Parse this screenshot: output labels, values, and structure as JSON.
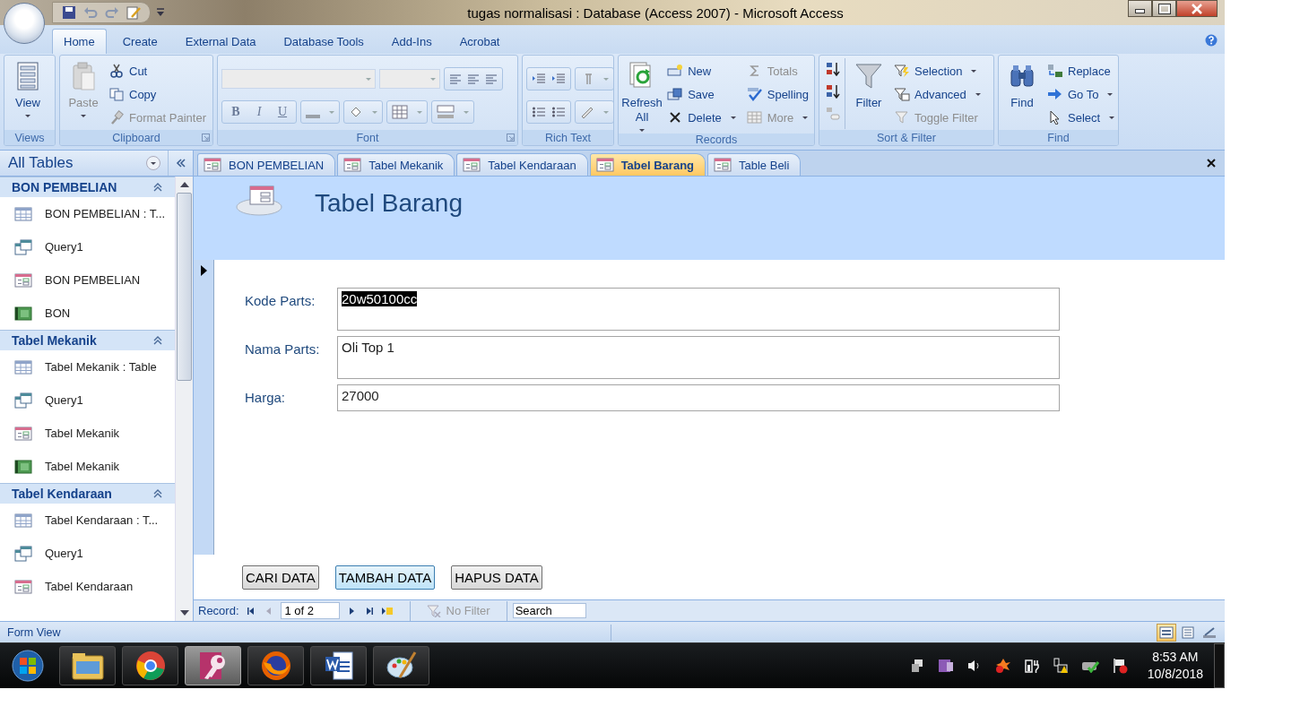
{
  "window": {
    "title": "tugas normalisasi : Database (Access 2007) - Microsoft Access"
  },
  "ribbon_tabs": [
    {
      "label": "Home",
      "selected": true
    },
    {
      "label": "Create",
      "selected": false
    },
    {
      "label": "External Data",
      "selected": false
    },
    {
      "label": "Database Tools",
      "selected": false
    },
    {
      "label": "Add-Ins",
      "selected": false
    },
    {
      "label": "Acrobat",
      "selected": false
    }
  ],
  "ribbon_groups": [
    {
      "label": "Views",
      "kind": "views",
      "commands": [
        {
          "label": "View",
          "kind": "large",
          "disabled": false,
          "menu": true
        }
      ]
    },
    {
      "label": "Clipboard",
      "kind": "clipboard",
      "commands": [
        {
          "label": "Paste",
          "kind": "large",
          "disabled": true,
          "menu": true
        },
        {
          "label": "Cut",
          "kind": "small",
          "disabled": false,
          "menu": false
        },
        {
          "label": "Copy",
          "kind": "small",
          "disabled": false,
          "menu": false
        },
        {
          "label": "Format Painter",
          "kind": "small",
          "disabled": true,
          "menu": false
        }
      ]
    },
    {
      "label": "Font",
      "kind": "font",
      "format_buttons": [
        "B",
        "I",
        "U"
      ]
    },
    {
      "label": "Rich Text",
      "kind": "richtext"
    },
    {
      "label": "Records",
      "kind": "records",
      "commands": [
        {
          "label": "Refresh All",
          "kind": "large",
          "disabled": false,
          "menu": true
        },
        {
          "label": "New",
          "kind": "small",
          "disabled": false,
          "menu": false
        },
        {
          "label": "Save",
          "kind": "small",
          "disabled": false,
          "menu": false
        },
        {
          "label": "Delete",
          "kind": "small",
          "disabled": false,
          "menu": true
        },
        {
          "label": "Totals",
          "kind": "small",
          "disabled": true,
          "menu": false
        },
        {
          "label": "Spelling",
          "kind": "small",
          "disabled": false,
          "menu": false
        },
        {
          "label": "More",
          "kind": "small",
          "disabled": true,
          "menu": true
        }
      ]
    },
    {
      "label": "Sort & Filter",
      "kind": "sort",
      "commands": [
        {
          "label": "Filter",
          "kind": "large",
          "disabled": false,
          "menu": false
        },
        {
          "label": "Selection",
          "kind": "small",
          "disabled": false,
          "menu": true
        },
        {
          "label": "Advanced",
          "kind": "small",
          "disabled": false,
          "menu": true
        },
        {
          "label": "Toggle Filter",
          "kind": "small",
          "disabled": true,
          "menu": false
        }
      ]
    },
    {
      "label": "Find",
      "kind": "find",
      "commands": [
        {
          "label": "Find",
          "kind": "large",
          "disabled": false,
          "menu": false
        },
        {
          "label": "Replace",
          "kind": "small",
          "disabled": false,
          "menu": false
        },
        {
          "label": "Go To",
          "kind": "small",
          "disabled": false,
          "menu": true
        },
        {
          "label": "Select",
          "kind": "small",
          "disabled": false,
          "menu": true
        }
      ]
    }
  ],
  "navigation_pane": {
    "title": "All Tables",
    "groups": [
      {
        "name": "BON PEMBELIAN",
        "expanded": true,
        "items": [
          {
            "label": "BON PEMBELIAN : T...",
            "kind": "table"
          },
          {
            "label": "Query1",
            "kind": "query"
          },
          {
            "label": "BON PEMBELIAN",
            "kind": "form"
          },
          {
            "label": "BON",
            "kind": "report"
          }
        ]
      },
      {
        "name": "Tabel Mekanik",
        "expanded": true,
        "items": [
          {
            "label": "Tabel Mekanik : Table",
            "kind": "table"
          },
          {
            "label": "Query1",
            "kind": "query"
          },
          {
            "label": "Tabel Mekanik",
            "kind": "form"
          },
          {
            "label": "Tabel Mekanik",
            "kind": "report"
          }
        ]
      },
      {
        "name": "Tabel Kendaraan",
        "expanded": true,
        "items": [
          {
            "label": "Tabel Kendaraan : T...",
            "kind": "table"
          },
          {
            "label": "Query1",
            "kind": "query"
          },
          {
            "label": "Tabel Kendaraan",
            "kind": "form"
          }
        ]
      }
    ]
  },
  "document_tabs": [
    {
      "label": "BON PEMBELIAN",
      "selected": false
    },
    {
      "label": "Tabel Mekanik",
      "selected": false
    },
    {
      "label": "Tabel Kendaraan",
      "selected": false
    },
    {
      "label": "Tabel Barang",
      "selected": true
    },
    {
      "label": "Table Beli",
      "selected": false
    }
  ],
  "form": {
    "title": "Tabel Barang",
    "fields": [
      {
        "label": "Kode Parts:",
        "value": "20w50100cc",
        "highlighted": true,
        "kind": "multiline"
      },
      {
        "label": "Nama Parts:",
        "value": "Oli Top 1",
        "highlighted": false,
        "kind": "multiline"
      },
      {
        "label": "Harga:",
        "value": "27000",
        "highlighted": false,
        "kind": "single"
      }
    ],
    "buttons": [
      {
        "label": "CARI DATA",
        "focused": false
      },
      {
        "label": "TAMBAH DATA",
        "focused": true
      },
      {
        "label": "HAPUS DATA",
        "focused": false
      }
    ]
  },
  "record_navigator": {
    "label": "Record:",
    "position": "1 of 2",
    "filter": "No Filter",
    "search_placeholder": "Search"
  },
  "status_bar": {
    "text": "Form View",
    "views": [
      {
        "selected": true
      },
      {
        "selected": false
      },
      {
        "selected": false
      }
    ]
  },
  "taskbar": {
    "apps": [
      {
        "selected": false
      },
      {
        "selected": false
      },
      {
        "selected": true
      },
      {
        "selected": false
      },
      {
        "selected": false
      },
      {
        "selected": false
      }
    ],
    "time": "8:53 AM",
    "date": "10/8/2018"
  }
}
